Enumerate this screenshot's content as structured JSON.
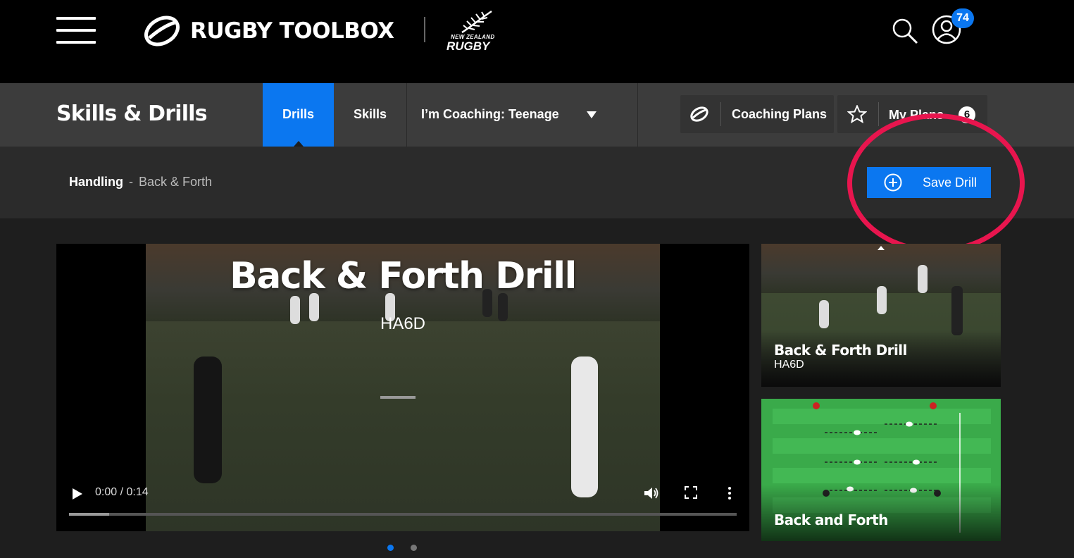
{
  "header": {
    "brand": "RUGBY TOOLBOX",
    "partner_small": "NEW ZEALAND",
    "partner_big": "RUGBY",
    "notification_count": "74"
  },
  "subnav": {
    "section_title": "Skills & Drills",
    "tabs": [
      {
        "label": "Drills",
        "active": true
      },
      {
        "label": "Skills",
        "active": false
      }
    ],
    "coaching_select": "I’m Coaching: Teenage",
    "coaching_plans_label": "Coaching Plans",
    "my_plans_label": "My Plans",
    "my_plans_count": "6"
  },
  "breadcrumb": {
    "category": "Handling",
    "separator": "-",
    "current": "Back & Forth"
  },
  "save_button": {
    "label": "Save Drill"
  },
  "video": {
    "title": "Back & Forth Drill",
    "code": "HA6D",
    "time": "0:00 / 0:14",
    "buffered": 0.06,
    "played": 0.0
  },
  "carousel": {
    "page_count": 2,
    "active_index": 0
  },
  "side_cards": [
    {
      "title": "Back & Forth Drill",
      "code": "HA6D"
    },
    {
      "title": "Back and Forth",
      "code": ""
    }
  ],
  "colors": {
    "accent": "#0b77f0",
    "highlight": "#e8154e"
  }
}
